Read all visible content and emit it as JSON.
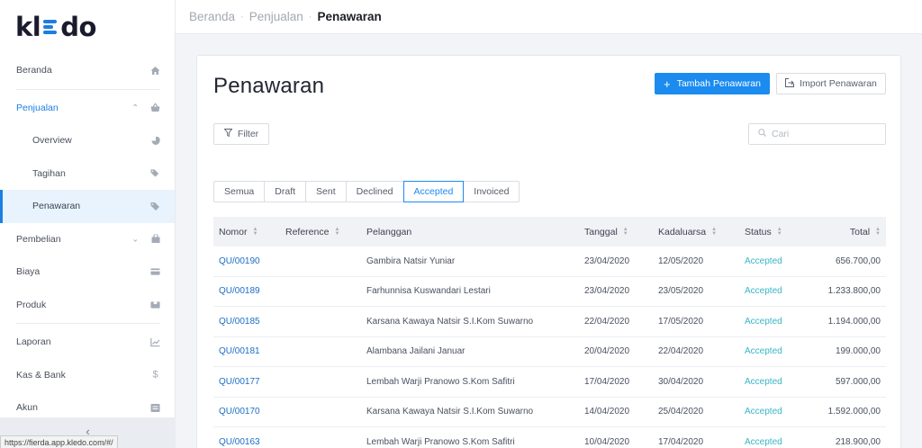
{
  "app": {
    "logo_text": "kledo"
  },
  "breadcrumb": {
    "items": [
      "Beranda",
      "Penjualan",
      "Penawaran"
    ],
    "separator": "·"
  },
  "sidebar": {
    "items": [
      {
        "label": "Beranda",
        "icon": "home-icon"
      },
      {
        "label": "Penjualan",
        "icon": "basket-icon",
        "expanded": true
      },
      {
        "label": "Overview",
        "icon": "pie-chart-icon"
      },
      {
        "label": "Tagihan",
        "icon": "tags-icon"
      },
      {
        "label": "Penawaran",
        "icon": "tag-icon",
        "active": true
      },
      {
        "label": "Pembelian",
        "icon": "shopping-bag-icon"
      },
      {
        "label": "Biaya",
        "icon": "credit-card-icon"
      },
      {
        "label": "Produk",
        "icon": "boxes-icon"
      },
      {
        "label": "Laporan",
        "icon": "line-chart-icon"
      },
      {
        "label": "Kas & Bank",
        "icon": "dollar-icon"
      },
      {
        "label": "Akun",
        "icon": "ledger-icon"
      }
    ],
    "collapse_glyph": "‹"
  },
  "status_url": "https://fierda.app.kledo.com/#/",
  "page": {
    "title": "Penawaran",
    "add_button": "Tambah Penawaran",
    "import_button": "Import Penawaran",
    "filter_button": "Filter",
    "search_placeholder": "Cari"
  },
  "tabs": [
    "Semua",
    "Draft",
    "Sent",
    "Declined",
    "Accepted",
    "Invoiced"
  ],
  "selected_tab": "Accepted",
  "table": {
    "columns": [
      "Nomor",
      "Reference",
      "Pelanggan",
      "Tanggal",
      "Kadaluarsa",
      "Status",
      "Total"
    ],
    "rows": [
      {
        "nomor": "QU/00190",
        "reference": "",
        "pelanggan": "Gambira Natsir Yuniar",
        "tanggal": "23/04/2020",
        "kadaluarsa": "12/05/2020",
        "status": "Accepted",
        "total": "656.700,00"
      },
      {
        "nomor": "QU/00189",
        "reference": "",
        "pelanggan": "Farhunnisa Kuswandari Lestari",
        "tanggal": "23/04/2020",
        "kadaluarsa": "23/05/2020",
        "status": "Accepted",
        "total": "1.233.800,00"
      },
      {
        "nomor": "QU/00185",
        "reference": "",
        "pelanggan": "Karsana Kawaya Natsir S.I.Kom Suwarno",
        "tanggal": "22/04/2020",
        "kadaluarsa": "17/05/2020",
        "status": "Accepted",
        "total": "1.194.000,00"
      },
      {
        "nomor": "QU/00181",
        "reference": "",
        "pelanggan": "Alambana Jailani Januar",
        "tanggal": "20/04/2020",
        "kadaluarsa": "22/04/2020",
        "status": "Accepted",
        "total": "199.000,00"
      },
      {
        "nomor": "QU/00177",
        "reference": "",
        "pelanggan": "Lembah Warji Pranowo S.Kom Safitri",
        "tanggal": "17/04/2020",
        "kadaluarsa": "30/04/2020",
        "status": "Accepted",
        "total": "597.000,00"
      },
      {
        "nomor": "QU/00170",
        "reference": "",
        "pelanggan": "Karsana Kawaya Natsir S.I.Kom Suwarno",
        "tanggal": "14/04/2020",
        "kadaluarsa": "25/04/2020",
        "status": "Accepted",
        "total": "1.592.000,00"
      },
      {
        "nomor": "QU/00163",
        "reference": "",
        "pelanggan": "Lembah Warji Pranowo S.Kom Safitri",
        "tanggal": "10/04/2020",
        "kadaluarsa": "17/04/2020",
        "status": "Accepted",
        "total": "218.900,00"
      }
    ]
  },
  "colors": {
    "primary": "#1b8bf0",
    "link": "#1b6fc8",
    "status_accepted": "#38b6c6",
    "active_nav_bg": "#e8f3fd"
  }
}
